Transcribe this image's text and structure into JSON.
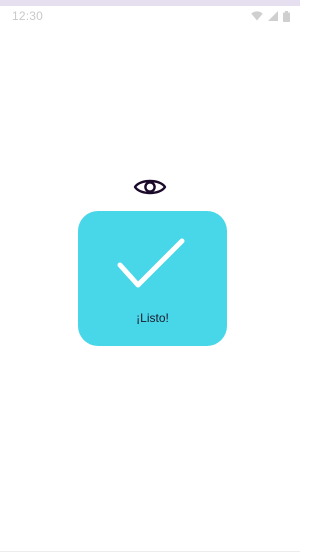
{
  "status_bar": {
    "time": "12:30",
    "icons": [
      "wifi-icon",
      "cellular-signal-icon",
      "battery-icon"
    ]
  },
  "visibility_toggle": {
    "icon": "eye-icon"
  },
  "success_card": {
    "icon": "checkmark-icon",
    "label": "¡Listo!"
  },
  "colors": {
    "accent_bar": "#e6dff0",
    "card_background": "#48d6e9",
    "checkmark": "#ffffff",
    "eye_icon": "#1b0a2a",
    "status_text": "#c9c9c9"
  }
}
